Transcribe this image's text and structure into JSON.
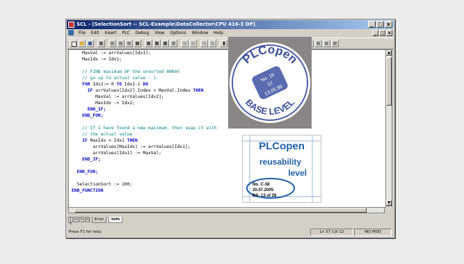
{
  "window": {
    "title": "SCL - [SelectionSort -- SCL-Example\\DataCollector\\CPU 416-3 DP]",
    "controls": [
      "_",
      "□",
      "x"
    ],
    "doc_controls": [
      "_",
      "□",
      "x"
    ]
  },
  "menu": [
    "File",
    "Edit",
    "Insert",
    "PLC",
    "Debug",
    "View",
    "Options",
    "Window",
    "Help"
  ],
  "code_lines": [
    [
      {
        "t": "    MaxVal := arrValues[Idx1];",
        "c": ""
      }
    ],
    [
      {
        "t": "    MaxIdx := Idx1;",
        "c": ""
      }
    ],
    [
      {
        "t": "",
        "c": ""
      }
    ],
    [
      {
        "t": "    // FIND maximum OF the unsorted ARRAY",
        "c": "cm"
      }
    ],
    [
      {
        "t": "    // go up to actual value - 1",
        "c": "cm"
      }
    ],
    [
      {
        "t": "    FOR",
        "c": "kw"
      },
      {
        "t": " Idx2:= 0 ",
        "c": ""
      },
      {
        "t": "TO",
        "c": "kw"
      },
      {
        "t": " Idx1-1 ",
        "c": ""
      },
      {
        "t": "DO",
        "c": "kw"
      }
    ],
    [
      {
        "t": "      IF",
        "c": "kw"
      },
      {
        "t": " arrValues[Idx2].Index > MaxVal.Index ",
        "c": ""
      },
      {
        "t": "THEN",
        "c": "kw"
      }
    ],
    [
      {
        "t": "         MaxVal := arrValues[Idx2];",
        "c": ""
      }
    ],
    [
      {
        "t": "         MaxIdx := Idx2;",
        "c": ""
      }
    ],
    [
      {
        "t": "      END_IF;",
        "c": "kw"
      }
    ],
    [
      {
        "t": "    END_FOR;",
        "c": "kw"
      }
    ],
    [
      {
        "t": "",
        "c": ""
      }
    ],
    [
      {
        "t": "    // If I have found a new maximum, then swap it with",
        "c": "cm"
      }
    ],
    [
      {
        "t": "    // the actual value",
        "c": "cm"
      }
    ],
    [
      {
        "t": "    IF",
        "c": "kw"
      },
      {
        "t": " MaxIdx < Idx1 ",
        "c": ""
      },
      {
        "t": "THEN",
        "c": "kw"
      }
    ],
    [
      {
        "t": "        arrValues[MaxIdx] := arrValues[Idx1];",
        "c": ""
      }
    ],
    [
      {
        "t": "        arrValues[Idx1] := MaxVal;",
        "c": ""
      }
    ],
    [
      {
        "t": "    END_IF;",
        "c": "kw"
      }
    ],
    [
      {
        "t": "",
        "c": ""
      }
    ],
    [
      {
        "t": "  END_FOR;",
        "c": "kw"
      }
    ],
    [
      {
        "t": "",
        "c": ""
      }
    ],
    [
      {
        "t": "  SelectionSort := 100;",
        "c": ""
      }
    ],
    [
      {
        "t": "END_FUNCTION",
        "c": "kw"
      }
    ]
  ],
  "tabs": {
    "nav": [
      "|<",
      "<",
      ">",
      ">|"
    ],
    "items": [
      "Error",
      "Info"
    ],
    "active": "Info"
  },
  "status": {
    "message": "Press F1 for help.",
    "position": "Ln 37 Col 12",
    "modes": "INS  MOD"
  },
  "logo_top": {
    "brand": "PLCopen",
    "level_text": "BASE LEVEL",
    "seal": [
      "No. 19",
      "07",
      "13.05.98"
    ]
  },
  "logo_bottom": {
    "brand": "PLCopen",
    "line1": "reusability",
    "line2": "level",
    "no": "No. C-38",
    "date": "20.07.2005",
    "ds": "DS: 13 of 28"
  },
  "colors": {
    "title_start": "#0a246a",
    "title_end": "#a6caf0",
    "keyword": "#0000c0",
    "comment": "#008080",
    "logo_blue": "#1d5fa8",
    "seal_blue": "#4a5ea8"
  }
}
